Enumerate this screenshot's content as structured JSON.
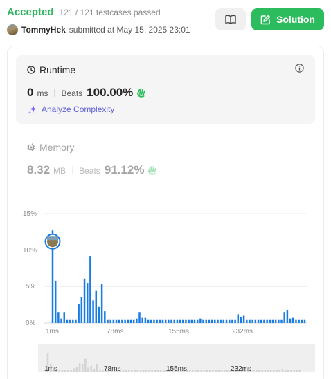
{
  "header": {
    "status": "Accepted",
    "testcases": "121 / 121 testcases passed",
    "user": "TommyHek",
    "submitted_text": "submitted at May 15, 2025 23:01",
    "solution_label": "Solution",
    "accent": "#2cbb5d",
    "icons": [
      "book-icon",
      "edit-icon"
    ]
  },
  "runtime": {
    "title": "Runtime",
    "value": "0",
    "unit": "ms",
    "beats_label": "Beats",
    "beats_pct": "100.00%",
    "analyze_label": "Analyze Complexity",
    "analyze_color": "#5b5fd6"
  },
  "memory": {
    "title": "Memory",
    "value": "8.32",
    "unit": "MB",
    "beats_label": "Beats",
    "beats_pct": "91.12%"
  },
  "chart_data": {
    "type": "bar",
    "y_ticks": [
      "15%",
      "10%",
      "5%",
      "0%"
    ],
    "ylim": [
      0,
      15
    ],
    "x_ticks": [
      "1ms",
      "78ms",
      "155ms",
      "232ms"
    ],
    "bar_color": "#1a7ce3",
    "values": [
      12.7,
      5.8,
      1.5,
      0.6,
      1.5,
      0.5,
      0.5,
      0.5,
      0.5,
      2.6,
      3.6,
      6.1,
      5.5,
      9.2,
      3.1,
      4.4,
      2.2,
      5.4,
      1.6,
      0.5,
      0.5,
      0.5,
      0.5,
      0.5,
      0.5,
      0.5,
      0.5,
      0.5,
      0.5,
      0.6,
      1.5,
      0.7,
      0.7,
      0.5,
      0.5,
      0.5,
      0.5,
      0.5,
      0.5,
      0.5,
      0.5,
      0.5,
      0.5,
      0.5,
      0.5,
      0.5,
      0.5,
      0.5,
      0.5,
      0.5,
      0.5,
      0.6,
      0.5,
      0.5,
      0.5,
      0.5,
      0.5,
      0.5,
      0.5,
      0.5,
      0.5,
      0.5,
      0.5,
      0.5,
      1.2,
      0.8,
      1.0,
      0.5,
      0.5,
      0.5,
      0.5,
      0.5,
      0.5,
      0.5,
      0.5,
      0.5,
      0.5,
      0.5,
      0.5,
      0.5,
      1.5,
      1.8,
      0.6,
      0.7,
      0.5,
      0.5,
      0.5,
      0.5
    ],
    "marker_index": 0
  }
}
